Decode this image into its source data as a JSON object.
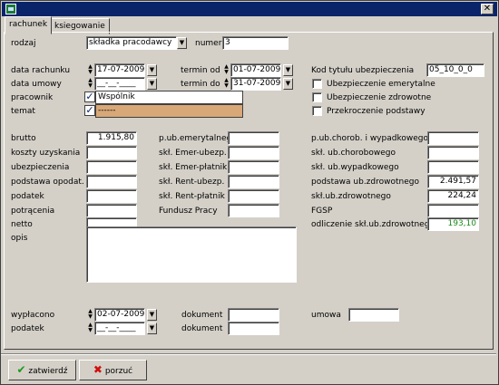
{
  "window": {
    "title": ""
  },
  "tabs": [
    "rachunek",
    "ksiegowanie"
  ],
  "form": {
    "rodzaj_label": "rodzaj",
    "rodzaj_value": "składka pracodawcy",
    "numer_label": "numer",
    "numer_value": "3",
    "data_rachunku_label": "data rachunku",
    "data_rachunku_value": "17-07-2009",
    "data_umowy_label": "data umowy",
    "data_umowy_value": "__-__-____",
    "termin_od_label": "termin od",
    "termin_od_value": "01-07-2009",
    "termin_do_label": "termin do",
    "termin_do_value": "31-07-2009",
    "pracownik_label": "pracownik",
    "pracownik_value": "Wspólnik",
    "temat_label": "temat",
    "temat_value": "------",
    "kod_label": "Kod tytułu ubezpieczenia",
    "kod_value": "05_10_0_0",
    "chk_emerytalne": "Ubezpieczenie emerytalne",
    "chk_zdrowotne": "Ubezpieczenie zdrowotne",
    "chk_przekroczenie": "Przekroczenie podstawy"
  },
  "col1": [
    {
      "label": "brutto",
      "value": "1.915,80"
    },
    {
      "label": "koszty uzyskania",
      "value": ""
    },
    {
      "label": "ubezpieczenia",
      "value": ""
    },
    {
      "label": "podstawa opodat.",
      "value": ""
    },
    {
      "label": "podatek",
      "value": ""
    },
    {
      "label": "potrącenia",
      "value": ""
    },
    {
      "label": "netto",
      "value": ""
    }
  ],
  "col2": [
    {
      "label": "p.ub.emerytalnego",
      "value": ""
    },
    {
      "label": "skł. Emer-ubezp.",
      "value": ""
    },
    {
      "label": "skł. Emer-płatnik",
      "value": ""
    },
    {
      "label": "skł. Rent-ubezp.",
      "value": ""
    },
    {
      "label": "skł. Rent-płatnik",
      "value": ""
    },
    {
      "label": "Fundusz Pracy",
      "value": ""
    }
  ],
  "col3": [
    {
      "label": "p.ub.chorob. i wypadkowego",
      "value": ""
    },
    {
      "label": "skł. ub.chorobowego",
      "value": ""
    },
    {
      "label": "skł. ub.wypadkowego",
      "value": ""
    },
    {
      "label": "podstawa ub.zdrowotnego",
      "value": "2.491,57"
    },
    {
      "label": "skł.ub.zdrowotnego",
      "value": "224,24"
    },
    {
      "label": "FGSP",
      "value": ""
    },
    {
      "label": "odliczenie skł.ub.zdrowotnego",
      "value": "193,10"
    }
  ],
  "opis_label": "opis",
  "opis_value": "",
  "bottom": {
    "wyplacono_label": "wypłacono",
    "wyplacono_value": "02-07-2009",
    "podatek_label": "podatek",
    "podatek_value": "__-__-____",
    "dokument1_label": "dokument",
    "dokument1_value": "",
    "dokument2_label": "dokument",
    "dokument2_value": "",
    "umowa_label": "umowa",
    "umowa_value": ""
  },
  "buttons": {
    "ok": "zatwierdź",
    "cancel": "porzuć"
  },
  "colors": {
    "titlebar": "#0a246a",
    "green_value": "#1a8a1a",
    "temat_bg": "#d8a878"
  }
}
